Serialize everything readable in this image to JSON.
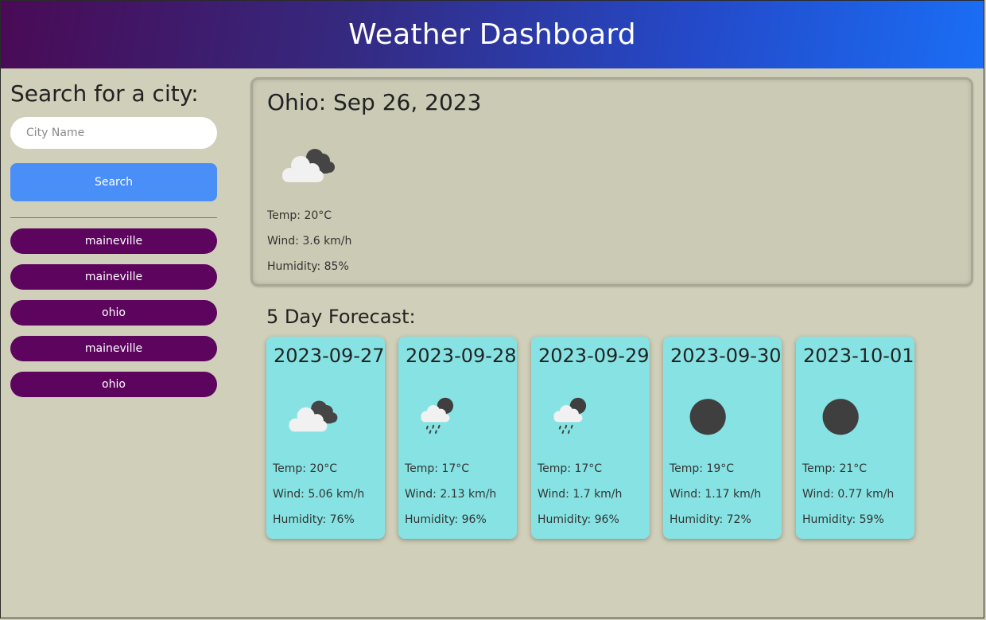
{
  "header": {
    "title": "Weather Dashboard"
  },
  "sidebar": {
    "heading": "Search for a city:",
    "search_placeholder": "City Name",
    "search_value": "",
    "search_button_label": "Search",
    "history": [
      {
        "label": "maineville"
      },
      {
        "label": "maineville"
      },
      {
        "label": "ohio"
      },
      {
        "label": "maineville"
      },
      {
        "label": "ohio"
      }
    ]
  },
  "current": {
    "title": "Ohio: Sep 26, 2023",
    "icon": "cloudy-icon",
    "temp": "Temp: 20°C",
    "wind": "Wind: 3.6 km/h",
    "humidity": "Humidity: 85%"
  },
  "forecast": {
    "heading": "5 Day Forecast:",
    "days": [
      {
        "date": "2023-09-27",
        "icon": "cloudy-icon",
        "temp": "Temp: 20°C",
        "wind": "Wind: 5.06 km/h",
        "humidity": "Humidity: 76%"
      },
      {
        "date": "2023-09-28",
        "icon": "rain-icon",
        "temp": "Temp: 17°C",
        "wind": "Wind: 2.13 km/h",
        "humidity": "Humidity: 96%"
      },
      {
        "date": "2023-09-29",
        "icon": "rain-icon",
        "temp": "Temp: 17°C",
        "wind": "Wind: 1.7 km/h",
        "humidity": "Humidity: 96%"
      },
      {
        "date": "2023-09-30",
        "icon": "moon-icon",
        "temp": "Temp: 19°C",
        "wind": "Wind: 1.17 km/h",
        "humidity": "Humidity: 72%"
      },
      {
        "date": "2023-10-01",
        "icon": "moon-icon",
        "temp": "Temp: 21°C",
        "wind": "Wind: 0.77 km/h",
        "humidity": "Humidity: 59%"
      }
    ]
  },
  "colors": {
    "header_gradient_start": "#4a0a55",
    "header_gradient_end": "#1a6ef5",
    "page_background": "#d0cfb9",
    "search_button": "#4a8ff7",
    "history_button": "#5d045e",
    "forecast_card": "#87e3e3"
  }
}
